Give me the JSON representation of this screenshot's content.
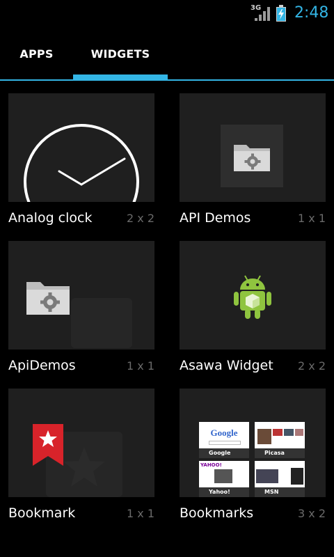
{
  "status_bar": {
    "network": "3G",
    "time": "2:48",
    "accent_color": "#33b5e5"
  },
  "tabs": [
    {
      "label": "APPS",
      "selected": false
    },
    {
      "label": "WIDGETS",
      "selected": true
    }
  ],
  "widgets": [
    {
      "name": "Analog clock",
      "size": "2 x 2",
      "preview_icon": "analog-clock-icon"
    },
    {
      "name": "API Demos",
      "size": "1 x 1",
      "preview_icon": "folder-gear-icon"
    },
    {
      "name": "ApiDemos",
      "size": "1 x 1",
      "preview_icon": "folder-gear-icon"
    },
    {
      "name": "Asawa Widget",
      "size": "2 x 2",
      "preview_icon": "android-robot-icon"
    },
    {
      "name": "Bookmark",
      "size": "1 x 1",
      "preview_icon": "bookmark-star-icon"
    },
    {
      "name": "Bookmarks",
      "size": "3 x 2",
      "preview_icon": "bookmark-thumbnails-icon",
      "thumbnails": [
        {
          "label": "Google",
          "logo": "Google"
        },
        {
          "label": "Picasa"
        },
        {
          "label": "Yahoo!",
          "logo": "YAHOO!"
        },
        {
          "label": "MSN"
        }
      ]
    }
  ]
}
